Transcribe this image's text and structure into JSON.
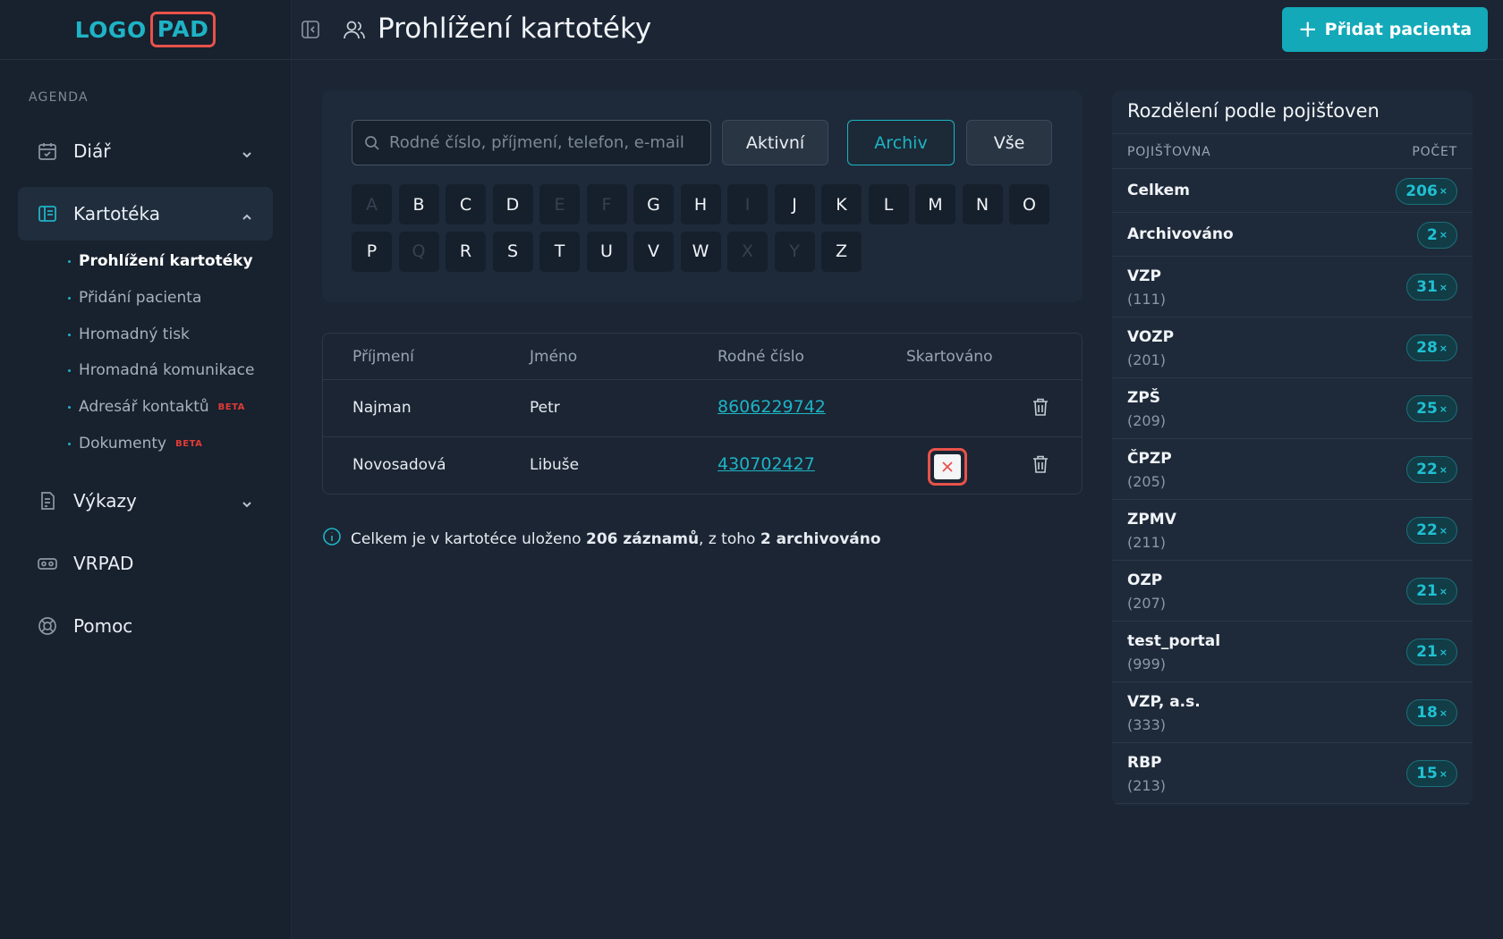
{
  "logo": {
    "part1": "LOGO",
    "part2": "PAD"
  },
  "sidebar": {
    "section_label": "AGENDA",
    "items": [
      {
        "label": "Diář"
      },
      {
        "label": "Kartotéka"
      },
      {
        "label": "Výkazy"
      },
      {
        "label": "VRPAD"
      },
      {
        "label": "Pomoc"
      }
    ],
    "subitems": [
      {
        "label": "Prohlížení kartotéky"
      },
      {
        "label": "Přidání pacienta"
      },
      {
        "label": "Hromadný tisk"
      },
      {
        "label": "Hromadná komunikace"
      },
      {
        "label": "Adresář kontaktů",
        "badge": "BETA"
      },
      {
        "label": "Dokumenty",
        "badge": "BETA"
      }
    ]
  },
  "header": {
    "title": "Prohlížení kartotéky",
    "add_button": "Přidat pacienta"
  },
  "filter": {
    "search_placeholder": "Rodné číslo, příjmení, telefon, e-mail",
    "tabs": [
      "Aktivní",
      "Archiv",
      "Vše"
    ],
    "selected_tab": "Archiv",
    "letters_row1": [
      {
        "l": "A",
        "enabled": false
      },
      {
        "l": "B",
        "enabled": true
      },
      {
        "l": "C",
        "enabled": true
      },
      {
        "l": "D",
        "enabled": true
      },
      {
        "l": "E",
        "enabled": false
      },
      {
        "l": "F",
        "enabled": false
      },
      {
        "l": "G",
        "enabled": true
      },
      {
        "l": "H",
        "enabled": true
      },
      {
        "l": "I",
        "enabled": false
      },
      {
        "l": "J",
        "enabled": true
      },
      {
        "l": "K",
        "enabled": true
      },
      {
        "l": "L",
        "enabled": true
      },
      {
        "l": "M",
        "enabled": true
      },
      {
        "l": "N",
        "enabled": true
      },
      {
        "l": "O",
        "enabled": true
      }
    ],
    "letters_row2": [
      {
        "l": "P",
        "enabled": true
      },
      {
        "l": "Q",
        "enabled": false
      },
      {
        "l": "R",
        "enabled": true
      },
      {
        "l": "S",
        "enabled": true
      },
      {
        "l": "T",
        "enabled": true
      },
      {
        "l": "U",
        "enabled": true
      },
      {
        "l": "V",
        "enabled": true
      },
      {
        "l": "W",
        "enabled": true
      },
      {
        "l": "X",
        "enabled": false
      },
      {
        "l": "Y",
        "enabled": false
      },
      {
        "l": "Z",
        "enabled": true
      }
    ]
  },
  "table": {
    "headers": [
      "Příjmení",
      "Jméno",
      "Rodné číslo",
      "Skartováno"
    ],
    "rows": [
      {
        "surname": "Najman",
        "name": "Petr",
        "birth_number": "8606229742",
        "shredded": false
      },
      {
        "surname": "Novosadová",
        "name": "Libuše",
        "birth_number": "430702427",
        "shredded": true
      }
    ]
  },
  "info": {
    "prefix": "Celkem je v kartotéce uloženo ",
    "total": "206 záznamů",
    "middle": ", z toho ",
    "archived": "2 archivováno"
  },
  "insurers": {
    "title": "Rozdělení podle pojišťoven",
    "col_insurer": "POJIŠŤOVNA",
    "col_count": "POČET",
    "rows": [
      {
        "name": "Celkem",
        "code": "",
        "count": "206"
      },
      {
        "name": "Archivováno",
        "code": "",
        "count": "2"
      },
      {
        "name": "VZP",
        "code": "(111)",
        "count": "31"
      },
      {
        "name": "VOZP",
        "code": "(201)",
        "count": "28"
      },
      {
        "name": "ZPŠ",
        "code": "(209)",
        "count": "25"
      },
      {
        "name": "ČPZP",
        "code": "(205)",
        "count": "22"
      },
      {
        "name": "ZPMV",
        "code": "(211)",
        "count": "22"
      },
      {
        "name": "OZP",
        "code": "(207)",
        "count": "21"
      },
      {
        "name": "test_portal",
        "code": "(999)",
        "count": "21"
      },
      {
        "name": "VZP, a.s.",
        "code": "(333)",
        "count": "18"
      },
      {
        "name": "RBP",
        "code": "(213)",
        "count": "15"
      }
    ],
    "count_suffix": "×"
  },
  "colors": {
    "accent": "#1eb3c5",
    "danger": "#e8524a",
    "background": "#1b2533"
  }
}
